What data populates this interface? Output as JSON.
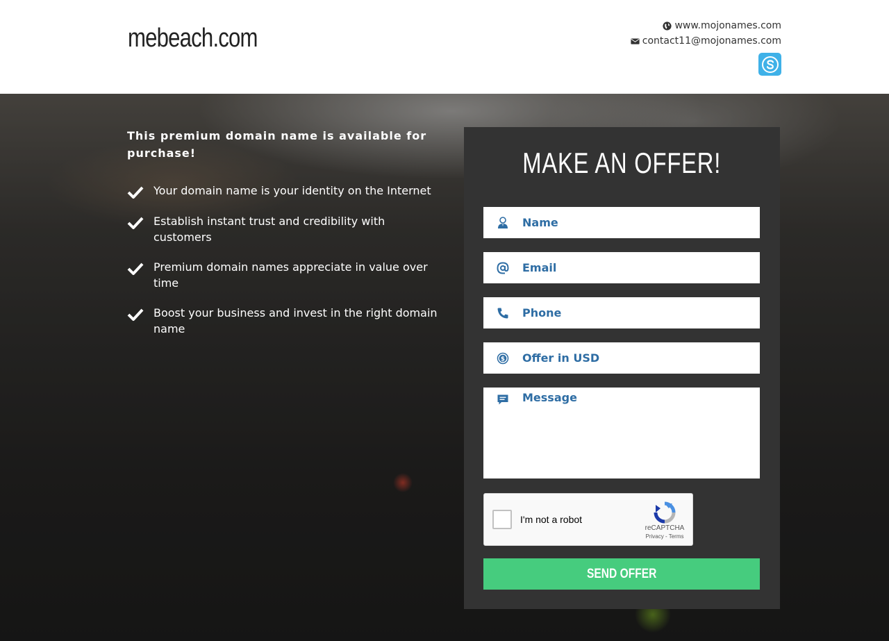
{
  "header": {
    "site_name": "mebeach.com",
    "website": "www.mojonames.com",
    "email": "contact11@mojonames.com",
    "icons": {
      "website": "globe-icon",
      "email": "envelope-icon",
      "social": "skype-icon"
    }
  },
  "intro": {
    "headline": "This premium domain name is available for purchase!",
    "features": [
      "Your domain name is your identity on the Internet",
      "Establish instant trust and credibility with customers",
      "Premium domain names appreciate in value over time",
      "Boost your business and invest in the right domain name"
    ]
  },
  "form": {
    "title": "MAKE AN OFFER!",
    "name_placeholder": "Name",
    "email_placeholder": "Email",
    "phone_placeholder": "Phone",
    "offer_placeholder": "Offer in USD",
    "message_placeholder": "Message",
    "captcha": {
      "label": "I'm not a robot",
      "brand": "reCAPTCHA",
      "terms": "Privacy - Terms"
    },
    "submit_label": "SEND OFFER"
  },
  "colors": {
    "accent": "#46cc7e",
    "panel": "#333333",
    "field_text": "#2e6da4",
    "skype": "#3fb1e8"
  }
}
